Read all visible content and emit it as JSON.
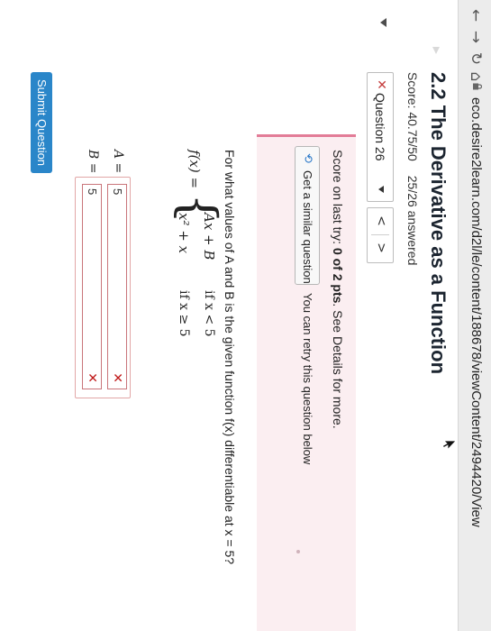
{
  "browser": {
    "back_glyph": "←",
    "forward_glyph": "→",
    "reload_glyph": "↻",
    "home_glyph": "⌂",
    "url": "eco.desire2learn.com/d2l/le/content/188678/viewContent/2494420/View"
  },
  "assignment": {
    "title": "2.2 The Derivative as a Function",
    "score_label": "Score: 40.75/50",
    "answered_label": "25/26 answered"
  },
  "question_nav": {
    "status_icon": "✕",
    "selected": "Question 26",
    "prev_glyph": "<",
    "next_glyph": ">"
  },
  "feedback": {
    "score_prefix": "Score on last try:",
    "score_value": "0 of 2 pts",
    "score_suffix": ". See Details for more.",
    "similar_icon": "⟲",
    "similar_button": "Get a similar question",
    "retry_note": "You can retry this question below"
  },
  "question": {
    "prompt": "For what values of A and B is the given function f(x) differentiable at x = 5?",
    "function_lhs": "f(x) =",
    "case1_expr": "Ax + B",
    "case1_cond": "if x < 5",
    "case2_expr": "x² + x",
    "case2_cond": "if x ≥ 5"
  },
  "answers": [
    {
      "label": "A =",
      "value": "5",
      "status_icon": "✕"
    },
    {
      "label": "B =",
      "value": "5",
      "status_icon": "✕"
    }
  ],
  "submit_label": "Submit Question",
  "colors": {
    "accent": "#2a86c9",
    "wrong": "#c01a1a",
    "feedback_bg": "#fbeef1",
    "feedback_border": "#e27c97"
  }
}
